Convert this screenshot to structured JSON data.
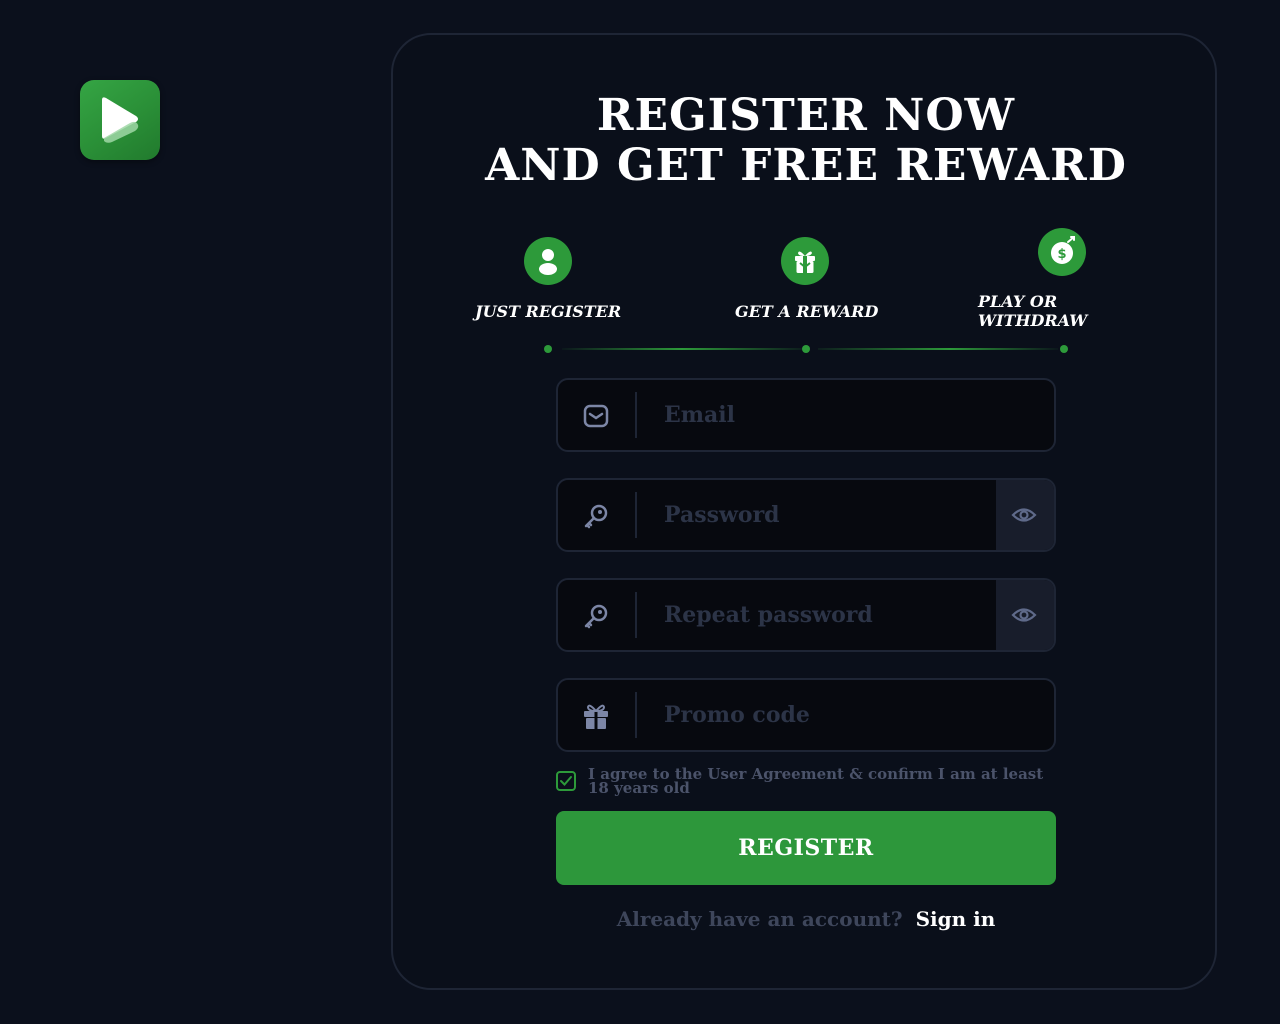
{
  "logo": {
    "icon": "play-logo-icon",
    "color": "#2d9a3a"
  },
  "title": {
    "line1": "REGISTER NOW",
    "line2": "AND GET FREE REWARD"
  },
  "steps": [
    {
      "icon": "user-icon",
      "label": "JUST REGISTER"
    },
    {
      "icon": "gift-box-icon",
      "label": "GET A REWARD"
    },
    {
      "icon": "money-bag-icon",
      "label_line1": "PLAY OR",
      "label_line2": "WITHDRAW"
    }
  ],
  "form": {
    "email": {
      "placeholder": "Email",
      "value": "",
      "icon": "mail-icon"
    },
    "password": {
      "placeholder": "Password",
      "value": "",
      "icon": "key-icon",
      "toggle_icon": "eye-icon"
    },
    "repeat_password": {
      "placeholder": "Repeat password",
      "value": "",
      "icon": "key-icon",
      "toggle_icon": "eye-icon"
    },
    "promo": {
      "placeholder": "Promo code",
      "value": "",
      "icon": "gift-icon"
    },
    "agree": {
      "checked": true,
      "text": "I agree to the User Agreement & confirm I am at least 18 years old"
    },
    "register_label": "REGISTER"
  },
  "signin": {
    "question": "Already have an account?",
    "link": "Sign in"
  },
  "colors": {
    "accent": "#2d9a3a",
    "background": "#0b101c",
    "card": "#0a0f1a"
  }
}
